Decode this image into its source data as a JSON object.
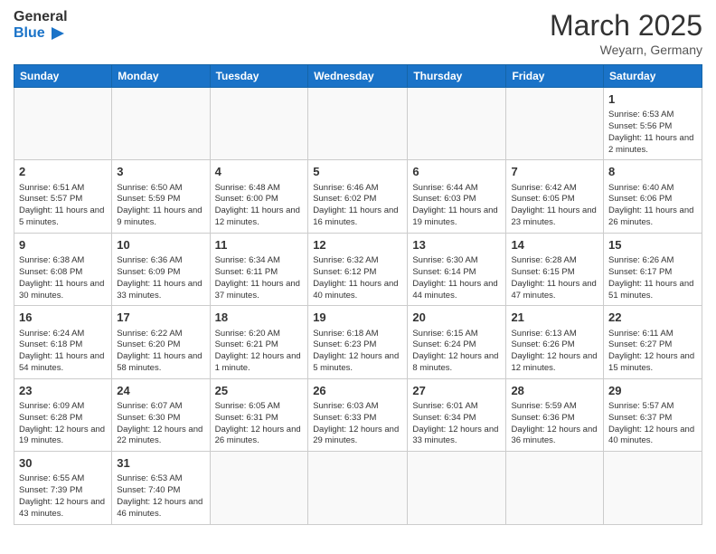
{
  "header": {
    "logo_general": "General",
    "logo_blue": "Blue",
    "month_title": "March 2025",
    "subtitle": "Weyarn, Germany"
  },
  "weekdays": [
    "Sunday",
    "Monday",
    "Tuesday",
    "Wednesday",
    "Thursday",
    "Friday",
    "Saturday"
  ],
  "weeks": [
    [
      {
        "day": "",
        "info": ""
      },
      {
        "day": "",
        "info": ""
      },
      {
        "day": "",
        "info": ""
      },
      {
        "day": "",
        "info": ""
      },
      {
        "day": "",
        "info": ""
      },
      {
        "day": "",
        "info": ""
      },
      {
        "day": "1",
        "info": "Sunrise: 6:53 AM\nSunset: 5:56 PM\nDaylight: 11 hours\nand 2 minutes."
      }
    ],
    [
      {
        "day": "2",
        "info": "Sunrise: 6:51 AM\nSunset: 5:57 PM\nDaylight: 11 hours\nand 5 minutes."
      },
      {
        "day": "3",
        "info": "Sunrise: 6:50 AM\nSunset: 5:59 PM\nDaylight: 11 hours\nand 9 minutes."
      },
      {
        "day": "4",
        "info": "Sunrise: 6:48 AM\nSunset: 6:00 PM\nDaylight: 11 hours\nand 12 minutes."
      },
      {
        "day": "5",
        "info": "Sunrise: 6:46 AM\nSunset: 6:02 PM\nDaylight: 11 hours\nand 16 minutes."
      },
      {
        "day": "6",
        "info": "Sunrise: 6:44 AM\nSunset: 6:03 PM\nDaylight: 11 hours\nand 19 minutes."
      },
      {
        "day": "7",
        "info": "Sunrise: 6:42 AM\nSunset: 6:05 PM\nDaylight: 11 hours\nand 23 minutes."
      },
      {
        "day": "8",
        "info": "Sunrise: 6:40 AM\nSunset: 6:06 PM\nDaylight: 11 hours\nand 26 minutes."
      }
    ],
    [
      {
        "day": "9",
        "info": "Sunrise: 6:38 AM\nSunset: 6:08 PM\nDaylight: 11 hours\nand 30 minutes."
      },
      {
        "day": "10",
        "info": "Sunrise: 6:36 AM\nSunset: 6:09 PM\nDaylight: 11 hours\nand 33 minutes."
      },
      {
        "day": "11",
        "info": "Sunrise: 6:34 AM\nSunset: 6:11 PM\nDaylight: 11 hours\nand 37 minutes."
      },
      {
        "day": "12",
        "info": "Sunrise: 6:32 AM\nSunset: 6:12 PM\nDaylight: 11 hours\nand 40 minutes."
      },
      {
        "day": "13",
        "info": "Sunrise: 6:30 AM\nSunset: 6:14 PM\nDaylight: 11 hours\nand 44 minutes."
      },
      {
        "day": "14",
        "info": "Sunrise: 6:28 AM\nSunset: 6:15 PM\nDaylight: 11 hours\nand 47 minutes."
      },
      {
        "day": "15",
        "info": "Sunrise: 6:26 AM\nSunset: 6:17 PM\nDaylight: 11 hours\nand 51 minutes."
      }
    ],
    [
      {
        "day": "16",
        "info": "Sunrise: 6:24 AM\nSunset: 6:18 PM\nDaylight: 11 hours\nand 54 minutes."
      },
      {
        "day": "17",
        "info": "Sunrise: 6:22 AM\nSunset: 6:20 PM\nDaylight: 11 hours\nand 58 minutes."
      },
      {
        "day": "18",
        "info": "Sunrise: 6:20 AM\nSunset: 6:21 PM\nDaylight: 12 hours\nand 1 minute."
      },
      {
        "day": "19",
        "info": "Sunrise: 6:18 AM\nSunset: 6:23 PM\nDaylight: 12 hours\nand 5 minutes."
      },
      {
        "day": "20",
        "info": "Sunrise: 6:15 AM\nSunset: 6:24 PM\nDaylight: 12 hours\nand 8 minutes."
      },
      {
        "day": "21",
        "info": "Sunrise: 6:13 AM\nSunset: 6:26 PM\nDaylight: 12 hours\nand 12 minutes."
      },
      {
        "day": "22",
        "info": "Sunrise: 6:11 AM\nSunset: 6:27 PM\nDaylight: 12 hours\nand 15 minutes."
      }
    ],
    [
      {
        "day": "23",
        "info": "Sunrise: 6:09 AM\nSunset: 6:28 PM\nDaylight: 12 hours\nand 19 minutes."
      },
      {
        "day": "24",
        "info": "Sunrise: 6:07 AM\nSunset: 6:30 PM\nDaylight: 12 hours\nand 22 minutes."
      },
      {
        "day": "25",
        "info": "Sunrise: 6:05 AM\nSunset: 6:31 PM\nDaylight: 12 hours\nand 26 minutes."
      },
      {
        "day": "26",
        "info": "Sunrise: 6:03 AM\nSunset: 6:33 PM\nDaylight: 12 hours\nand 29 minutes."
      },
      {
        "day": "27",
        "info": "Sunrise: 6:01 AM\nSunset: 6:34 PM\nDaylight: 12 hours\nand 33 minutes."
      },
      {
        "day": "28",
        "info": "Sunrise: 5:59 AM\nSunset: 6:36 PM\nDaylight: 12 hours\nand 36 minutes."
      },
      {
        "day": "29",
        "info": "Sunrise: 5:57 AM\nSunset: 6:37 PM\nDaylight: 12 hours\nand 40 minutes."
      }
    ],
    [
      {
        "day": "30",
        "info": "Sunrise: 6:55 AM\nSunset: 7:39 PM\nDaylight: 12 hours\nand 43 minutes."
      },
      {
        "day": "31",
        "info": "Sunrise: 6:53 AM\nSunset: 7:40 PM\nDaylight: 12 hours\nand 46 minutes."
      },
      {
        "day": "",
        "info": ""
      },
      {
        "day": "",
        "info": ""
      },
      {
        "day": "",
        "info": ""
      },
      {
        "day": "",
        "info": ""
      },
      {
        "day": "",
        "info": ""
      }
    ]
  ]
}
